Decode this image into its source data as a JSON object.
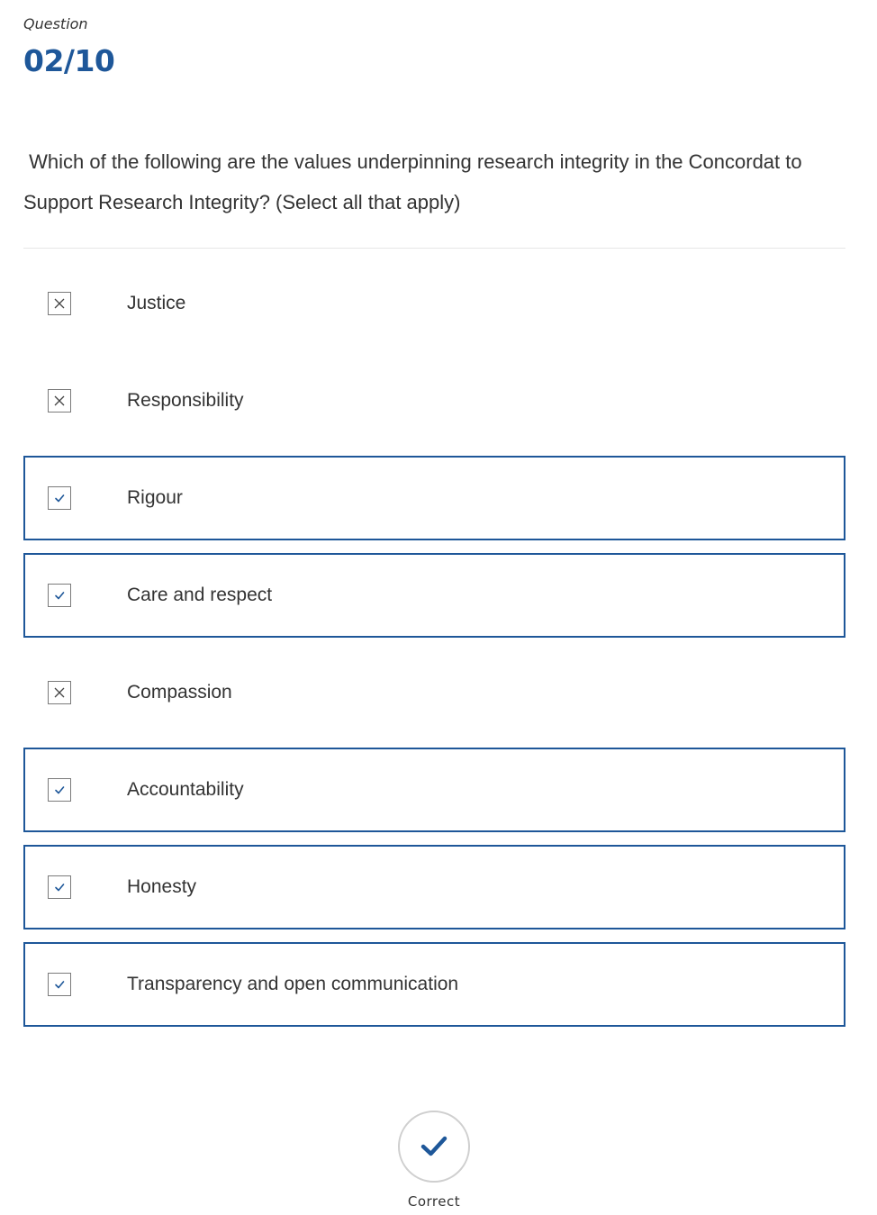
{
  "header": {
    "label": "Question",
    "counter": "02/10"
  },
  "question": {
    "text": " Which of the following are the values underpinning research integrity in the Concordat to Support Research Integrity? (Select all that apply)"
  },
  "options": [
    {
      "label": "Justice",
      "selected": false,
      "icon": "x-icon"
    },
    {
      "label": "Responsibility",
      "selected": false,
      "icon": "x-icon"
    },
    {
      "label": "Rigour",
      "selected": true,
      "icon": "checkmark-icon"
    },
    {
      "label": "Care and respect",
      "selected": true,
      "icon": "checkmark-icon"
    },
    {
      "label": "Compassion",
      "selected": false,
      "icon": "x-icon"
    },
    {
      "label": "Accountability",
      "selected": true,
      "icon": "checkmark-icon"
    },
    {
      "label": "Honesty",
      "selected": true,
      "icon": "checkmark-icon"
    },
    {
      "label": "Transparency and open communication",
      "selected": true,
      "icon": "checkmark-icon"
    }
  ],
  "result": {
    "label": "Correct",
    "icon": "checkmark-icon"
  },
  "colors": {
    "accent": "#1e5799",
    "text": "#333333",
    "border_muted": "#7a7a7a"
  }
}
